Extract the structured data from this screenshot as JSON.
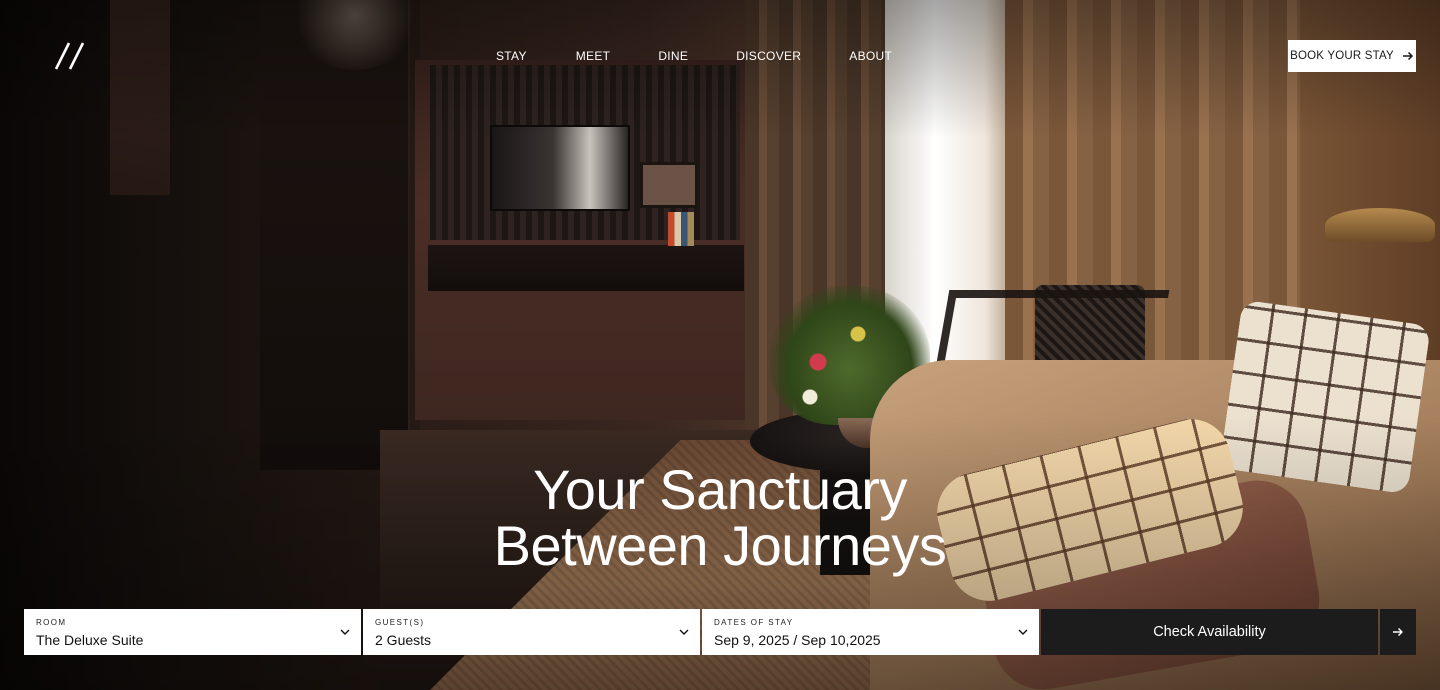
{
  "header": {
    "logo_icon": "double-slash-logo-icon",
    "nav": [
      {
        "label": "STAY"
      },
      {
        "label": "MEET"
      },
      {
        "label": "DINE"
      },
      {
        "label": "DISCOVER"
      },
      {
        "label": "ABOUT"
      }
    ],
    "book_button": {
      "label": "BOOK YOUR STAY",
      "icon": "arrow-right-icon"
    }
  },
  "hero": {
    "headline_line1": "Your Sanctuary",
    "headline_line2": "Between Journeys"
  },
  "booking": {
    "room": {
      "label": "ROOM",
      "value": "The Deluxe Suite",
      "icon": "chevron-down-icon"
    },
    "guests": {
      "label": "GUEST(S)",
      "value": "2 Guests",
      "icon": "chevron-down-icon"
    },
    "dates": {
      "label": "DATES OF STAY",
      "value": "Sep 9, 2025 / Sep 10,2025",
      "icon": "chevron-down-icon"
    },
    "check_button": {
      "label": "Check Availability"
    },
    "go_button": {
      "icon": "arrow-right-icon"
    }
  },
  "colors": {
    "button_dark": "#1c1c1c",
    "button_light": "#ffffff",
    "text_light": "#ffffff"
  }
}
